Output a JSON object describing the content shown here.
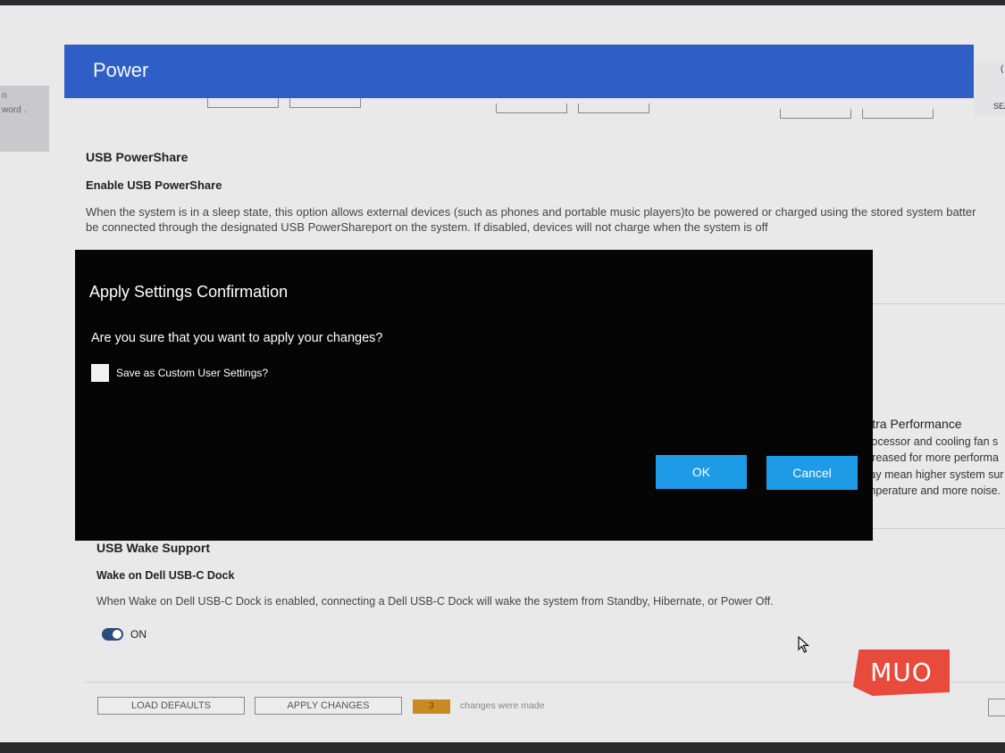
{
  "left_panel": {
    "lines": [
      "n",
      "word ."
    ]
  },
  "header": {
    "title": "Power",
    "right_label": "SEA",
    "right_dot": "("
  },
  "sections": {
    "usb_powershare": {
      "title": "USB PowerShare",
      "subtitle": "Enable USB PowerShare",
      "desc_line1": "When the system is in a sleep state, this option allows external devices (such as phones and portable music players)to be powered or charged using the stored system batter",
      "desc_line2": "be connected through the designated USB PowerShareport on the system. If disabled, devices will not charge when the system is off"
    },
    "ultra_performance": {
      "title": "Ultra Performance",
      "lines": [
        "Processor and cooling fan s",
        "ncreased for more performa",
        "may mean higher system sur",
        "emperature and more noise."
      ]
    },
    "usb_wake": {
      "title": "USB Wake Support",
      "subtitle": "Wake on Dell USB-C Dock",
      "desc": "When Wake on Dell USB-C Dock is enabled, connecting a Dell USB-C Dock will wake the system from Standby, Hibernate, or Power Off.",
      "toggle_label": "ON"
    }
  },
  "footer": {
    "load_defaults": "LOAD DEFAULTS",
    "apply_changes": "APPLY CHANGES",
    "changes_count": "3",
    "changes_text": "changes were made"
  },
  "dialog": {
    "title": "Apply Settings Confirmation",
    "question": "Are you sure that you want to apply your changes?",
    "checkbox_label": "Save as Custom User Settings?",
    "ok": "OK",
    "cancel": "Cancel"
  },
  "watermark": {
    "text": "MUO"
  },
  "colors": {
    "header": "#2f5fc6",
    "dialog_bg": "#050505",
    "button": "#1e9be6",
    "badge": "#c98a22",
    "logo": "#e84a3c"
  }
}
